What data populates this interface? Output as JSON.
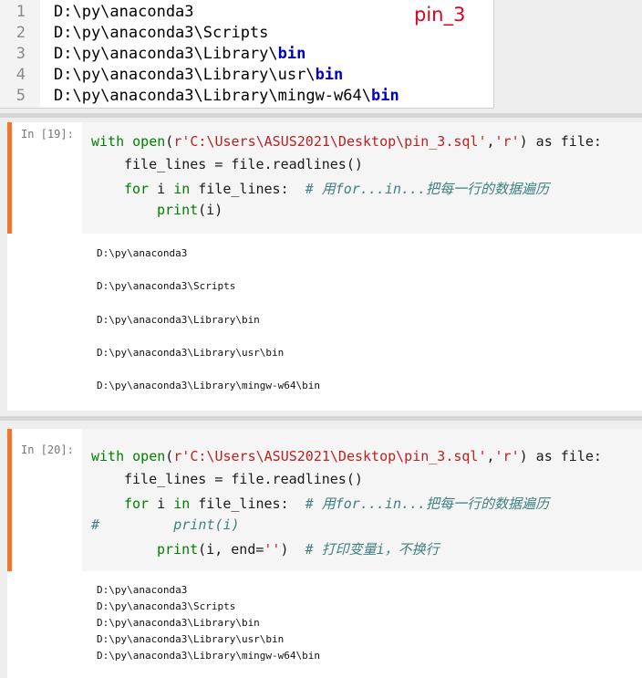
{
  "editor": {
    "line_numbers": [
      "1",
      "2",
      "3",
      "4",
      "5"
    ],
    "lines": [
      {
        "pre": "D:\\py\\anaconda3",
        "bold": ""
      },
      {
        "pre": "D:\\py\\anaconda3\\Scripts",
        "bold": ""
      },
      {
        "pre": "D:\\py\\anaconda3\\Library\\",
        "bold": "bin"
      },
      {
        "pre": "D:\\py\\anaconda3\\Library\\usr\\",
        "bold": "bin"
      },
      {
        "pre": "D:\\py\\anaconda3\\Library\\mingw-w64\\",
        "bold": "bin"
      }
    ],
    "annotation": "pin_3"
  },
  "cell1": {
    "prompt": "In [19]:",
    "code": {
      "l1_with": "with",
      "l1_open": "open",
      "l1_path": "r'C:\\Users\\ASUS2021\\Desktop\\pin_3.sql'",
      "l1_comma": ",",
      "l1_mode": "'r'",
      "l1_rest": ") as file:",
      "l2": "file_lines = file.readlines()",
      "l3_for": "for",
      "l3_i": " i ",
      "l3_in": "in",
      "l3_rest": " file_lines:  ",
      "l3_comment": "# 用for...in...把每一行的数据遍历",
      "l4_print": "print",
      "l4_rest": "(i)"
    },
    "output": [
      "D:\\py\\anaconda3",
      "D:\\py\\anaconda3\\Scripts",
      "D:\\py\\anaconda3\\Library\\bin",
      "D:\\py\\anaconda3\\Library\\usr\\bin",
      "D:\\py\\anaconda3\\Library\\mingw-w64\\bin"
    ]
  },
  "cell2": {
    "prompt": "In [20]:",
    "code": {
      "l1_with": "with",
      "l1_open": "open",
      "l1_path": "r'C:\\Users\\ASUS2021\\Desktop\\pin_3.sql'",
      "l1_comma": ",",
      "l1_mode": "'r'",
      "l1_rest": ") as file:",
      "l2": "file_lines = file.readlines()",
      "l3_for": "for",
      "l3_i": " i ",
      "l3_in": "in",
      "l3_rest": " file_lines:  ",
      "l3_comment": "# 用for...in...把每一行的数据遍历",
      "l4_comment": "#         print(i)",
      "l5_print": "print",
      "l5_args": "(i, end=",
      "l5_str": "''",
      "l5_close": ")  ",
      "l5_comment": "# 打印变量i，不换行"
    },
    "output": [
      "D:\\py\\anaconda3",
      "D:\\py\\anaconda3\\Scripts",
      "D:\\py\\anaconda3\\Library\\bin",
      "D:\\py\\anaconda3\\Library\\usr\\bin",
      "D:\\py\\anaconda3\\Library\\mingw-w64\\bin"
    ]
  },
  "colors": {
    "accent_bar": "#f37626",
    "annotation": "#e0001a",
    "bold_blue": "#0000c0"
  }
}
